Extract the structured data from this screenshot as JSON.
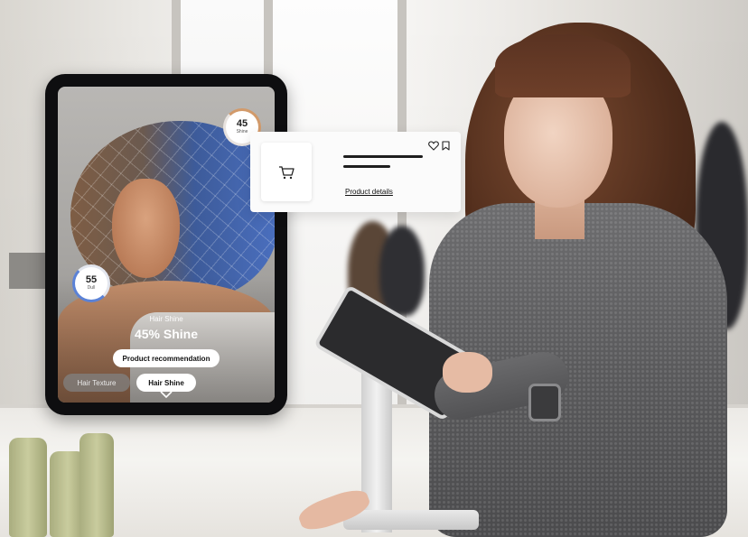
{
  "tablet_ui": {
    "shine_ring": {
      "value": "45",
      "label": "Shine"
    },
    "dull_ring": {
      "value": "55",
      "label": "Dull"
    },
    "metric_label": "Hair Shine",
    "metric_value": "45% Shine",
    "product_recommendation_label": "Product recommendation",
    "tabs": [
      {
        "label": "Hair Texture",
        "selected": false
      },
      {
        "label": "Hair Shine",
        "selected": true
      }
    ],
    "icons": {
      "expand": "chevron-down-icon"
    }
  },
  "product_card": {
    "details_link": "Product details",
    "icons": {
      "thumbnail": "cart-icon",
      "favorite": "heart-icon",
      "save": "bookmark-icon"
    }
  },
  "colors": {
    "shine_accent": "#d29a6a",
    "dull_accent": "#5b82d6",
    "frame_border": "#2e5a4e"
  }
}
